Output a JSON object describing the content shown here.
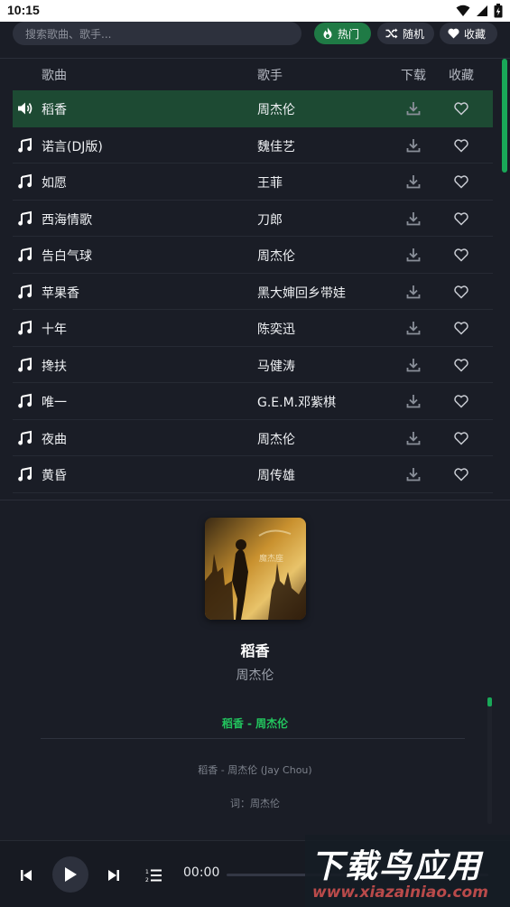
{
  "status_bar": {
    "time": "10:15"
  },
  "search": {
    "placeholder": "搜索歌曲、歌手..."
  },
  "chips": {
    "hot": "热门",
    "random": "随机",
    "favorites": "收藏"
  },
  "list_header": {
    "title": "歌曲",
    "artist": "歌手",
    "download": "下载",
    "favorite": "收藏"
  },
  "songs": [
    {
      "title": "稻香",
      "artist": "周杰伦",
      "playing": true
    },
    {
      "title": "诺言(DJ版)",
      "artist": "魏佳艺"
    },
    {
      "title": "如愿",
      "artist": "王菲"
    },
    {
      "title": "西海情歌",
      "artist": "刀郎"
    },
    {
      "title": "告白气球",
      "artist": "周杰伦"
    },
    {
      "title": "苹果香",
      "artist": "黑大婶回乡带娃"
    },
    {
      "title": "十年",
      "artist": "陈奕迅"
    },
    {
      "title": "搀扶",
      "artist": "马健涛"
    },
    {
      "title": "唯一",
      "artist": "G.E.M.邓紫棋"
    },
    {
      "title": "夜曲",
      "artist": "周杰伦"
    },
    {
      "title": "黄昏",
      "artist": "周传雄"
    }
  ],
  "now_playing": {
    "title": "稻香",
    "artist": "周杰伦",
    "lyric_current": "稻香 - 周杰伦",
    "lyric_lines": [
      "稻香 - 周杰伦 (Jay Chou)",
      "词：周杰伦"
    ]
  },
  "player": {
    "time": "00:00",
    "progress": 0
  },
  "watermark": {
    "main": "下载鸟应用",
    "url": "www.xiazainiao.com"
  },
  "colors": {
    "accent": "#1f7a45",
    "accent_bright": "#22c55e",
    "background": "#1a1d26",
    "active_row": "#1d4a33"
  }
}
